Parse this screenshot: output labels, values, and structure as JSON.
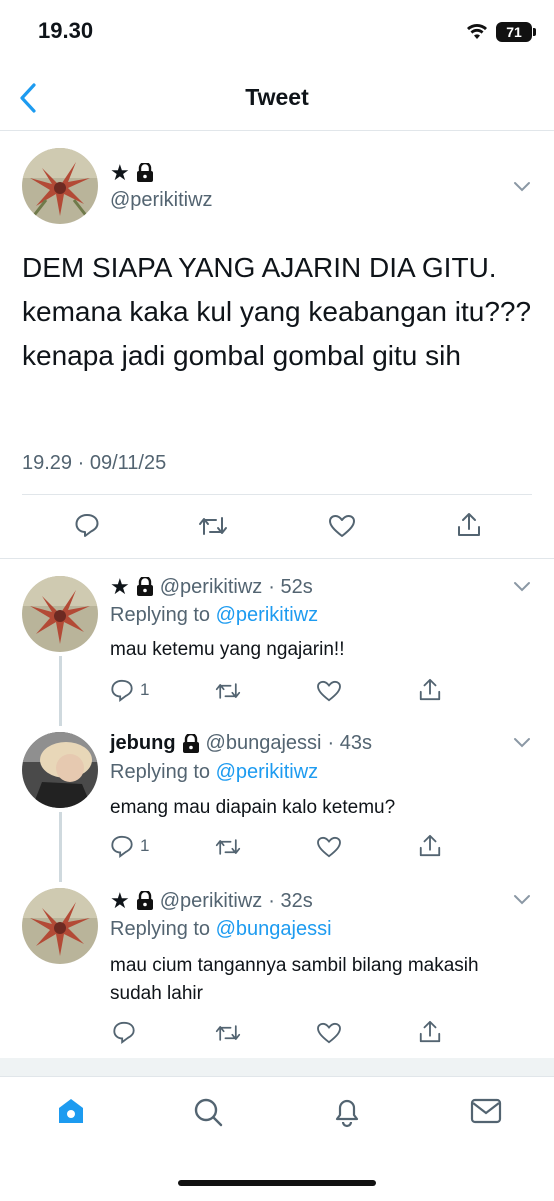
{
  "status_bar": {
    "time": "19.30",
    "battery": "71"
  },
  "header": {
    "title": "Tweet"
  },
  "main_tweet": {
    "name_icons": "★ 🔒",
    "handle": "@perikitiwz",
    "text": "DEM SIAPA YANG AJARIN DIA GITU. kemana kaka kul yang keabangan itu??? kenapa jadi gombal gombal gitu sih",
    "timestamp": "19.29 · 09/11/25"
  },
  "replies": [
    {
      "name": "★",
      "handle": "@perikitiwz",
      "time": "· 52s",
      "replying_prefix": "Replying to",
      "replying_to": "@perikitiwz",
      "text": "mau ketemu yang ngajarin!!",
      "reply_count": "1"
    },
    {
      "name": "jebung",
      "handle": "@bungajessi",
      "time": "· 43s",
      "replying_prefix": "Replying to",
      "replying_to": "@perikitiwz",
      "text": "emang mau diapain kalo ketemu?",
      "reply_count": "1"
    },
    {
      "name": "★",
      "handle": "@perikitiwz",
      "time": "· 32s",
      "replying_prefix": "Replying to",
      "replying_to": "@bungajessi",
      "text": "mau cium tangannya sambil bilang makasih sudah lahir",
      "reply_count": ""
    }
  ],
  "tabs": [
    "home",
    "search",
    "notifications",
    "messages"
  ],
  "colors": {
    "accent": "#1d9bf0",
    "secondary_text": "#536471",
    "divider": "#e1e6ea"
  }
}
